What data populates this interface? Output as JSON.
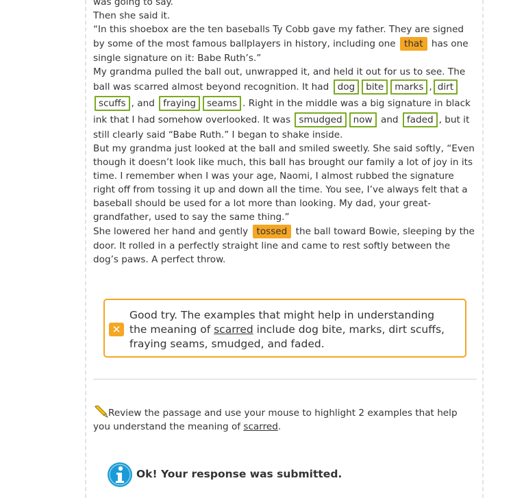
{
  "passage": {
    "line_cut": "was going to say.",
    "p1": "Then she said it.",
    "p2": {
      "a": "“In this shoebox are the ten baseballs Ty Cobb gave my father. They are signed by some of the most famous ballplayers in history, including one",
      "hl_that": "that",
      "b": "has one single signature on it: Babe Ruth’s.”"
    },
    "p3": {
      "a": "My grandma pulled the ball out, unwrapped it, and held it out for us to see. The ball was scarred almost beyond recognition. It had",
      "dog": "dog",
      "bite": "bite",
      "marks": "marks",
      "comma1": ",",
      "dirt": "dirt",
      "scuffs": "scuffs",
      "and1": ", and",
      "fraying": "fraying",
      "seams": "seams",
      "b": ". Right in the middle was a big signature in black ink that I had somehow overlooked. It was",
      "smudged": "smudged",
      "now": "now",
      "and2": "and",
      "faded": "faded",
      "c": ", but it still clearly said “Babe Ruth.” I began to shake inside."
    },
    "p4": "But my grandma just looked at the ball and smiled sweetly. She said softly, “Even though it doesn’t look like much, this ball has brought our family a lot of joy in its time. I remember when I was your age, Naomi, I almost rubbed the signature right off from tossing it up and down all the time. You see, I’ve always felt that a baseball should be used for a lot more than looking. My dad, your great-grandfather, used to say the same thing.”",
    "p5": {
      "a": "She lowered her hand and gently",
      "hl_tossed": "tossed",
      "b": "the ball toward Bowie, sleeping by the door. It rolled in a perfectly straight line and came to rest softly between the dog’s paws. A perfect throw."
    }
  },
  "feedback": {
    "icon": "x-icon",
    "a": "Good try. The examples that might help in understanding the meaning of",
    "word": "scarred",
    "b": "include dog bite, marks, dirt scuffs, fraying seams, smudged, and faded."
  },
  "prompt": {
    "icon": "pencil-icon",
    "a": "Review the passage and use your mouse to highlight 2 examples that help you understand the meaning of",
    "word": "scarred",
    "b": "."
  },
  "status": {
    "icon": "info-icon",
    "text": "Ok! Your response was submitted."
  },
  "colors": {
    "green_highlight": "#7aaa1f",
    "orange_highlight": "#f5a623",
    "info_blue": "#1a9bd7"
  }
}
